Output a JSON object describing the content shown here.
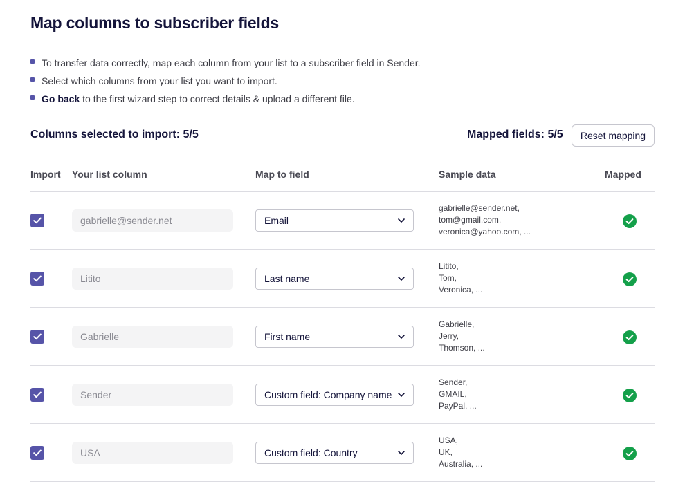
{
  "title": "Map columns to subscriber fields",
  "bullets": {
    "b1": "To transfer data correctly, map each column from your list to a subscriber field in Sender.",
    "b2": "Select which columns from your list you want to import.",
    "b3_link": "Go back",
    "b3_rest": " to the first wizard step to correct details & upload a different file."
  },
  "summary": {
    "selected": "Columns selected to import: 5/5",
    "mapped": "Mapped fields: 5/5",
    "reset_label": "Reset mapping"
  },
  "headers": {
    "import": "Import",
    "column": "Your list column",
    "map": "Map to field",
    "sample": "Sample data",
    "mapped": "Mapped"
  },
  "colors": {
    "accent": "#5654a8",
    "success": "#14a04a"
  },
  "rows": [
    {
      "column": "gabrielle@sender.net",
      "field": "Email",
      "sample": [
        "gabrielle@sender.net,",
        "tom@gmail.com,",
        "veronica@yahoo.com, ..."
      ]
    },
    {
      "column": "Litito",
      "field": "Last name",
      "sample": [
        "Litito,",
        "Tom,",
        "Veronica, ..."
      ]
    },
    {
      "column": "Gabrielle",
      "field": "First name",
      "sample": [
        "Gabrielle,",
        "Jerry,",
        "Thomson, ..."
      ]
    },
    {
      "column": "Sender",
      "field": "Custom field: Company name",
      "sample": [
        "Sender,",
        "GMAIL,",
        "PayPal, ..."
      ]
    },
    {
      "column": "USA",
      "field": "Custom field: Country",
      "sample": [
        "USA,",
        "UK,",
        "Australia, ..."
      ]
    }
  ]
}
